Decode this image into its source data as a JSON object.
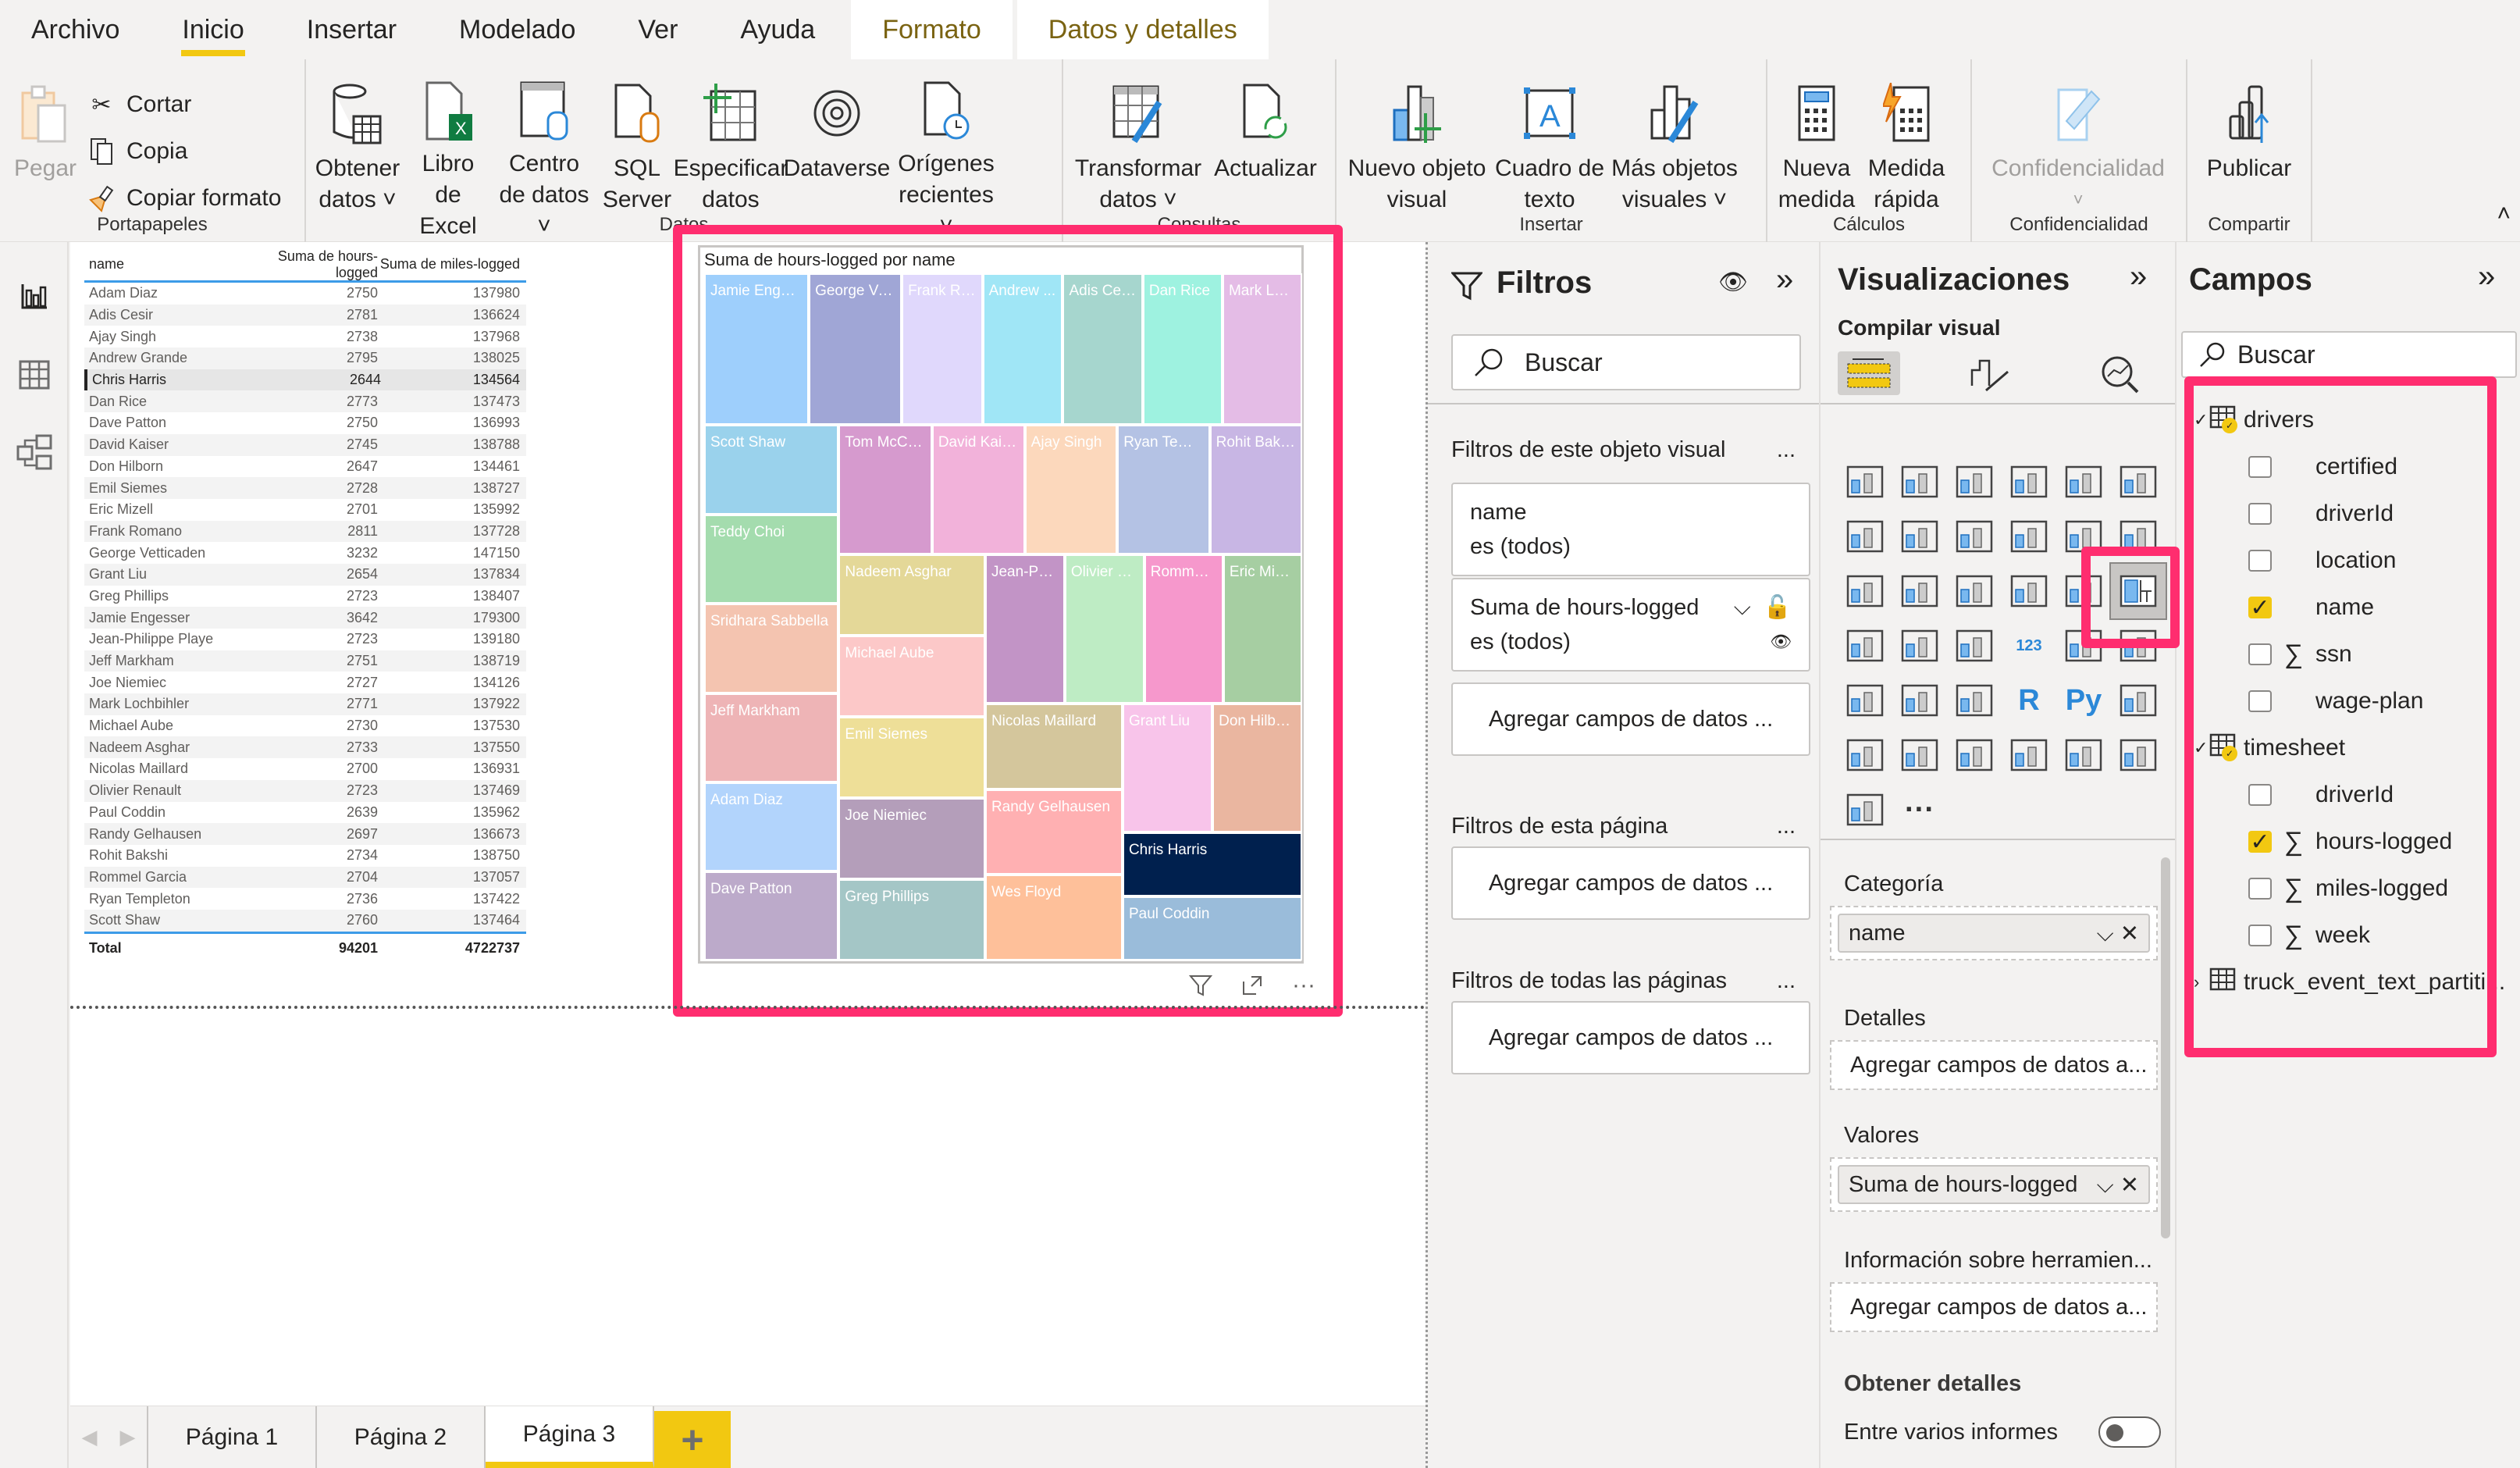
{
  "menu": {
    "tabs": [
      {
        "label": "Archivo",
        "active": false,
        "contextual": false
      },
      {
        "label": "Inicio",
        "active": true,
        "contextual": false
      },
      {
        "label": "Insertar",
        "active": false,
        "contextual": false
      },
      {
        "label": "Modelado",
        "active": false,
        "contextual": false
      },
      {
        "label": "Ver",
        "active": false,
        "contextual": false
      },
      {
        "label": "Ayuda",
        "active": false,
        "contextual": false
      },
      {
        "label": "Formato",
        "active": false,
        "contextual": true
      },
      {
        "label": "Datos y detalles",
        "active": false,
        "contextual": true
      }
    ]
  },
  "ribbon": {
    "portapapeles": {
      "label": "Portapapeles",
      "paste": "Pegar",
      "cut": "Cortar",
      "copy": "Copia",
      "format_painter": "Copiar formato"
    },
    "datos": {
      "label": "Datos",
      "get_data": "Obtener datos ˅",
      "excel": "Libro de Excel",
      "hub": "Centro de datos ˅",
      "sql": "SQL Server",
      "enter": "Especificar datos",
      "dataverse": "Dataverse",
      "recent": "Orígenes recientes ˅"
    },
    "consultas": {
      "label": "Consultas",
      "transform": "Transformar datos ˅",
      "refresh": "Actualizar"
    },
    "insertar": {
      "label": "Insertar",
      "new_visual": "Nuevo objeto visual",
      "textbox": "Cuadro de texto",
      "more_visuals": "Más objetos visuales ˅"
    },
    "calculos": {
      "label": "Cálculos",
      "new_measure": "Nueva medida",
      "quick_measure": "Medida rápida"
    },
    "confidencialidad": {
      "label": "Confidencialidad",
      "sensitivity": "Confidencialidad",
      "chevron": "˅"
    },
    "compartir": {
      "label": "Compartir",
      "publish": "Publicar"
    },
    "collapse": "˄"
  },
  "table_visual": {
    "columns": [
      "name",
      "Suma de hours-logged",
      "Suma de miles-logged"
    ],
    "rows": [
      [
        "Adam Diaz",
        "2750",
        "137980"
      ],
      [
        "Adis Cesir",
        "2781",
        "136624"
      ],
      [
        "Ajay Singh",
        "2738",
        "137968"
      ],
      [
        "Andrew Grande",
        "2795",
        "138025"
      ],
      [
        "Chris Harris",
        "2644",
        "134564"
      ],
      [
        "Dan Rice",
        "2773",
        "137473"
      ],
      [
        "Dave Patton",
        "2750",
        "136993"
      ],
      [
        "David Kaiser",
        "2745",
        "138788"
      ],
      [
        "Don Hilborn",
        "2647",
        "134461"
      ],
      [
        "Emil Siemes",
        "2728",
        "138727"
      ],
      [
        "Eric Mizell",
        "2701",
        "135992"
      ],
      [
        "Frank Romano",
        "2811",
        "137728"
      ],
      [
        "George Vetticaden",
        "3232",
        "147150"
      ],
      [
        "Grant Liu",
        "2654",
        "137834"
      ],
      [
        "Greg Phillips",
        "2723",
        "138407"
      ],
      [
        "Jamie Engesser",
        "3642",
        "179300"
      ],
      [
        "Jean-Philippe Playe",
        "2723",
        "139180"
      ],
      [
        "Jeff Markham",
        "2751",
        "138719"
      ],
      [
        "Joe Niemiec",
        "2727",
        "134126"
      ],
      [
        "Mark Lochbihler",
        "2771",
        "137922"
      ],
      [
        "Michael Aube",
        "2730",
        "137530"
      ],
      [
        "Nadeem Asghar",
        "2733",
        "137550"
      ],
      [
        "Nicolas Maillard",
        "2700",
        "136931"
      ],
      [
        "Olivier Renault",
        "2723",
        "137469"
      ],
      [
        "Paul Coddin",
        "2639",
        "135962"
      ],
      [
        "Randy Gelhausen",
        "2697",
        "136673"
      ],
      [
        "Rohit Bakshi",
        "2734",
        "138750"
      ],
      [
        "Rommel Garcia",
        "2704",
        "137057"
      ],
      [
        "Ryan Templeton",
        "2736",
        "137422"
      ],
      [
        "Scott Shaw",
        "2760",
        "137464"
      ]
    ],
    "selected_row": "Chris Harris",
    "total": [
      "Total",
      "94201",
      "4722737"
    ]
  },
  "chart_data": {
    "type": "treemap",
    "title": "Suma de hours-logged por name",
    "category_field": "name",
    "value_field": "Suma de hours-logged",
    "items": [
      {
        "name": "Jamie Engesser",
        "label": "Jamie Engess...",
        "value": 3642,
        "color": "#9ecffc"
      },
      {
        "name": "George Vetticaden",
        "label": "George Vet...",
        "value": 3232,
        "color": "#a0a6d6"
      },
      {
        "name": "Frank Romano",
        "label": "Frank Ro...",
        "value": 2811,
        "color": "#e0d8fc"
      },
      {
        "name": "Andrew Grande",
        "label": "Andrew ...",
        "value": 2795,
        "color": "#a0e6f6"
      },
      {
        "name": "Adis Cesir",
        "label": "Adis Cesir",
        "value": 2781,
        "color": "#a6d6ce"
      },
      {
        "name": "Dan Rice",
        "label": "Dan Rice",
        "value": 2773,
        "color": "#9ef2e0"
      },
      {
        "name": "Mark Lochbihler",
        "label": "Mark Loc...",
        "value": 2771,
        "color": "#e4bce6"
      },
      {
        "name": "Scott Shaw",
        "label": "Scott Shaw",
        "value": 2760,
        "color": "#9ad2ec"
      },
      {
        "name": "Teddy Choi",
        "label": "Teddy Choi",
        "value": 2760,
        "color": "#a4dcae"
      },
      {
        "name": "Tom McCuch",
        "label": "Tom McCuch",
        "value": 2758,
        "color": "#d69ace"
      },
      {
        "name": "David Kaiser",
        "label": "David Kaiser",
        "value": 2745,
        "color": "#f2b2da"
      },
      {
        "name": "Ajay Singh",
        "label": "Ajay Singh",
        "value": 2738,
        "color": "#fcd8bc"
      },
      {
        "name": "Ryan Templeton",
        "label": "Ryan Temp...",
        "value": 2736,
        "color": "#b4c2e4"
      },
      {
        "name": "Rohit Bakshi",
        "label": "Rohit Bakshi",
        "value": 2734,
        "color": "#c8b6e4"
      },
      {
        "name": "Sridhara Sabbella",
        "label": "Sridhara Sabbella",
        "value": 2752,
        "color": "#f4c4b0"
      },
      {
        "name": "Nadeem Asghar",
        "label": "Nadeem Asghar",
        "value": 2733,
        "color": "#e4d898"
      },
      {
        "name": "Jean-Philippe Playe",
        "label": "Jean-Phil...",
        "value": 2723,
        "color": "#c294c6"
      },
      {
        "name": "Olivier Renault",
        "label": "Olivier R...",
        "value": 2723,
        "color": "#beecc4"
      },
      {
        "name": "Rommel Garcia",
        "label": "Rommel ...",
        "value": 2704,
        "color": "#f698cc"
      },
      {
        "name": "Eric Mizell",
        "label": "Eric Mizell",
        "value": 2701,
        "color": "#a6cea2"
      },
      {
        "name": "Jeff Markham",
        "label": "Jeff Markham",
        "value": 2751,
        "color": "#eeb4b6"
      },
      {
        "name": "Michael Aube",
        "label": "Michael Aube",
        "value": 2730,
        "color": "#fcc8c8"
      },
      {
        "name": "Emil Siemes",
        "label": "Emil Siemes",
        "value": 2728,
        "color": "#eedf98"
      },
      {
        "name": "Nicolas Maillard",
        "label": "Nicolas Maillard",
        "value": 2700,
        "color": "#d4c69c"
      },
      {
        "name": "Grant Liu",
        "label": "Grant Liu",
        "value": 2654,
        "color": "#f8c4ea"
      },
      {
        "name": "Don Hilborn",
        "label": "Don Hilborn",
        "value": 2647,
        "color": "#eab6a0"
      },
      {
        "name": "Adam Diaz",
        "label": "Adam Diaz",
        "value": 2750,
        "color": "#b2d4fc"
      },
      {
        "name": "Joe Niemiec",
        "label": "Joe Niemiec",
        "value": 2727,
        "color": "#b49eba"
      },
      {
        "name": "Randy Gelhausen",
        "label": "Randy Gelhausen",
        "value": 2697,
        "color": "#ffb0b2"
      },
      {
        "name": "Chris Harris",
        "label": "Chris Harris",
        "value": 2644,
        "color": "#00204e"
      },
      {
        "name": "Dave Patton",
        "label": "Dave Patton",
        "value": 2750,
        "color": "#bcaaca"
      },
      {
        "name": "Greg Phillips",
        "label": "Greg Phillips",
        "value": 2723,
        "color": "#a4c6c6"
      },
      {
        "name": "Wes Floyd",
        "label": "Wes Floyd",
        "value": 2700,
        "color": "#fec09a"
      },
      {
        "name": "Paul Coddin",
        "label": "Paul Coddin",
        "value": 2639,
        "color": "#9abcda"
      }
    ]
  },
  "page_tabs": {
    "items": [
      "Página 1",
      "Página 2",
      "Página 3"
    ],
    "active": "Página 3",
    "add": "+"
  },
  "filters": {
    "title": "Filtros",
    "search_placeholder": "Buscar",
    "visual_section": "Filtros de este objeto visual",
    "page_section": "Filtros de esta página",
    "all_section": "Filtros de todas las páginas",
    "more": "...",
    "cards": [
      {
        "field": "name",
        "state": "es (todos)"
      },
      {
        "field": "Suma de hours-logged",
        "state": "es (todos)"
      }
    ],
    "add_label": "Agregar campos de datos ..."
  },
  "visualizations": {
    "title": "Visualizaciones",
    "subtitle": "Compilar visual",
    "selected_visual": "treemap",
    "wells": {
      "category": {
        "label": "Categoría",
        "value": "name"
      },
      "details": {
        "label": "Detalles",
        "placeholder": "Agregar campos de datos a..."
      },
      "values": {
        "label": "Valores",
        "value": "Suma de hours-logged"
      },
      "tooltips": {
        "label": "Información sobre herramien...",
        "placeholder": "Agregar campos de datos a..."
      }
    },
    "drillthrough": {
      "title": "Obtener detalles",
      "cross_report": "Entre varios informes",
      "cross_report_on": false
    },
    "more": "..."
  },
  "fields": {
    "title": "Campos",
    "search_placeholder": "Buscar",
    "tables": [
      {
        "name": "drivers",
        "expanded": true,
        "fields": [
          {
            "name": "certified",
            "checked": false,
            "sigma": false
          },
          {
            "name": "driverId",
            "checked": false,
            "sigma": false
          },
          {
            "name": "location",
            "checked": false,
            "sigma": false
          },
          {
            "name": "name",
            "checked": true,
            "sigma": false
          },
          {
            "name": "ssn",
            "checked": false,
            "sigma": true
          },
          {
            "name": "wage-plan",
            "checked": false,
            "sigma": false
          }
        ]
      },
      {
        "name": "timesheet",
        "expanded": true,
        "fields": [
          {
            "name": "driverId",
            "checked": false,
            "sigma": false
          },
          {
            "name": "hours-logged",
            "checked": true,
            "sigma": true
          },
          {
            "name": "miles-logged",
            "checked": false,
            "sigma": true
          },
          {
            "name": "week",
            "checked": false,
            "sigma": true
          }
        ]
      },
      {
        "name": "truck_event_text_partiti...",
        "expanded": false,
        "fields": []
      }
    ]
  },
  "colors": {
    "accent": "#f2c811",
    "highlight": "#ff2d6f",
    "table_rule": "#3c9be8"
  }
}
